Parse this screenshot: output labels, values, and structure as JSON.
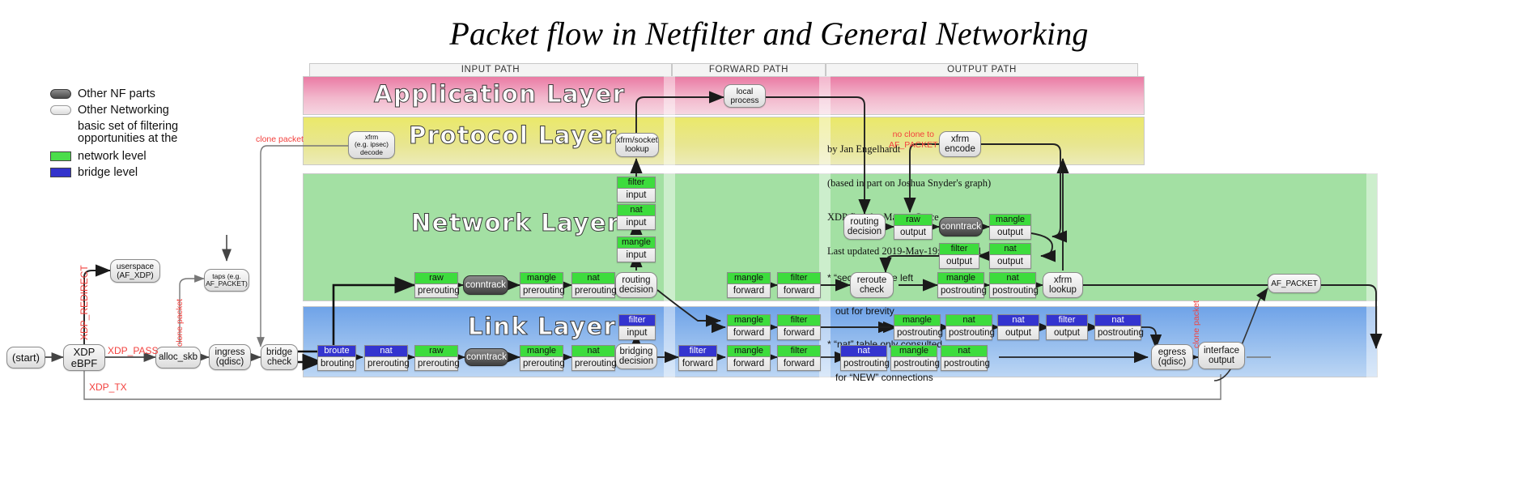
{
  "title": "Packet flow in Netfilter and General Networking",
  "legend": {
    "items": [
      {
        "swatch": "dark-pill",
        "label": "Other NF parts"
      },
      {
        "swatch": "light-pill",
        "label": "Other Networking"
      }
    ],
    "note_line1": "basic set of filtering",
    "note_line2": "opportunities at the",
    "levels": [
      {
        "swatch": "green",
        "color": "#4bdd4b",
        "label": "network level"
      },
      {
        "swatch": "blue",
        "color": "#3333cc",
        "label": "bridge level"
      }
    ]
  },
  "paths": [
    {
      "id": "input",
      "label": "INPUT PATH"
    },
    {
      "id": "forward",
      "label": "FORWARD PATH"
    },
    {
      "id": "output",
      "label": "OUTPUT PATH"
    }
  ],
  "layers": [
    {
      "id": "application",
      "label": "Application Layer",
      "color": "#ea7ba4"
    },
    {
      "id": "protocol",
      "label": "Protocol Layer",
      "color": "#eae86a"
    },
    {
      "id": "network",
      "label": "Network Layer",
      "color": "#a3e0a3"
    },
    {
      "id": "link",
      "label": "Link Layer",
      "color": "#6fa3e8"
    }
  ],
  "credits": {
    "line1": "by Jan Engelhardt",
    "line2": "(based in part on Joshua Snyder's graph)",
    "line3": "XDP flow by Matteo Croce",
    "line4": "Last updated 2019-May-19; Linux 5.1"
  },
  "footnotes": {
    "line1": "* “security” table left",
    "line2": "   out for brevity",
    "line3": "* “nat” table only consulted",
    "line4": "   for “NEW” connections"
  },
  "nodes": {
    "start": "(start)",
    "xdp_ebpf": "XDP\neBPF",
    "userspace_afxdp": "userspace\n(AF_XDP)",
    "alloc_skb": "alloc_skb",
    "ingress_qdisc": "ingress\n(qdisc)",
    "bridge_check": "bridge\ncheck",
    "taps_afpacket": "taps (e.g.\nAF_PACKET)",
    "conntrack": "conntrack",
    "routing_decision_in": "routing\ndecision",
    "bridging_decision": "bridging\ndecision",
    "xfrm_socket_lookup": "xfrm/socket\nlookup",
    "xfrm_decode": "xfrm\n(e.g. ipsec)\ndecode",
    "local_process": "local\nprocess",
    "routing_decision_out": "routing\ndecision",
    "reroute_check": "reroute\ncheck",
    "xfrm_lookup": "xfrm\nlookup",
    "xfrm_encode": "xfrm\nencode",
    "egress_qdisc": "egress\n(qdisc)",
    "interface_output": "interface\noutput",
    "af_packet": "AF_PACKET"
  },
  "edge_labels": {
    "xdp_redirect": "XDP_REDIRECT",
    "xdp_pass": "XDP_PASS",
    "xdp_tx": "XDP_TX",
    "clone_packet_left": "clone packet",
    "clone_packet_tap": "clone packet",
    "clone_packet_right": "clone packet",
    "no_clone": "no clone to\nAF_PACKET",
    "no_clone_l1": "no clone to",
    "no_clone_l2": "AF_PACKET"
  },
  "tables": {
    "input_network": [
      {
        "table": "raw",
        "chain": "prerouting",
        "level": "green"
      },
      {
        "table": "mangle",
        "chain": "prerouting",
        "level": "green"
      },
      {
        "table": "nat",
        "chain": "prerouting",
        "level": "green"
      },
      {
        "table": "mangle",
        "chain": "input",
        "level": "green"
      },
      {
        "table": "nat",
        "chain": "input",
        "level": "green"
      },
      {
        "table": "filter",
        "chain": "input",
        "level": "green"
      }
    ],
    "input_link": [
      {
        "table": "broute",
        "chain": "brouting",
        "level": "blue"
      },
      {
        "table": "nat",
        "chain": "prerouting",
        "level": "blue"
      },
      {
        "table": "raw",
        "chain": "prerouting",
        "level": "green"
      },
      {
        "table": "mangle",
        "chain": "prerouting",
        "level": "green"
      },
      {
        "table": "nat",
        "chain": "prerouting",
        "level": "green"
      },
      {
        "table": "filter",
        "chain": "input",
        "level": "blue"
      }
    ],
    "forward_network": [
      {
        "table": "mangle",
        "chain": "forward",
        "level": "green"
      },
      {
        "table": "filter",
        "chain": "forward",
        "level": "green"
      }
    ],
    "forward_link": [
      {
        "table": "mangle",
        "chain": "forward",
        "level": "green"
      },
      {
        "table": "filter",
        "chain": "forward",
        "level": "green"
      },
      {
        "table": "filter",
        "chain": "forward",
        "level": "blue"
      },
      {
        "table": "mangle",
        "chain": "forward",
        "level": "green"
      },
      {
        "table": "filter",
        "chain": "forward",
        "level": "green"
      }
    ],
    "output_network": [
      {
        "table": "raw",
        "chain": "output",
        "level": "green"
      },
      {
        "table": "mangle",
        "chain": "output",
        "level": "green"
      },
      {
        "table": "nat",
        "chain": "output",
        "level": "green"
      },
      {
        "table": "filter",
        "chain": "output",
        "level": "green"
      },
      {
        "table": "mangle",
        "chain": "postrouting",
        "level": "green"
      },
      {
        "table": "nat",
        "chain": "postrouting",
        "level": "green"
      }
    ],
    "output_link": [
      {
        "table": "mangle",
        "chain": "postrouting",
        "level": "green"
      },
      {
        "table": "nat",
        "chain": "postrouting",
        "level": "green"
      },
      {
        "table": "nat",
        "chain": "output",
        "level": "blue"
      },
      {
        "table": "filter",
        "chain": "output",
        "level": "blue"
      },
      {
        "table": "nat",
        "chain": "postrouting",
        "level": "blue"
      },
      {
        "table": "nat",
        "chain": "postrouting",
        "level": "green"
      },
      {
        "table": "mangle",
        "chain": "postrouting",
        "level": "green"
      },
      {
        "table": "nat",
        "chain": "postrouting",
        "level": "green"
      }
    ]
  }
}
